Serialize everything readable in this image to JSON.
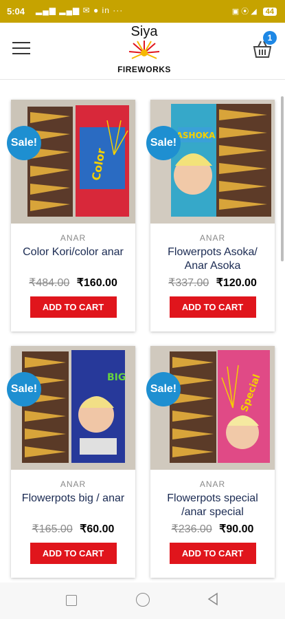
{
  "status": {
    "time": "5:04",
    "icons": "▂▄▆ ▂▄▆ ✉ ● in ···",
    "right": "▣ ⦿ ◢",
    "battery": "44"
  },
  "header": {
    "logo_top": "Siya",
    "logo_bottom": "FIREWORKS",
    "cart_count": "1"
  },
  "products": [
    {
      "category": "ANAR",
      "name": "Color Kori/color anar",
      "old_price": "₹484.00",
      "price": "₹160.00",
      "badge": "Sale!",
      "button": "ADD TO CART"
    },
    {
      "category": "ANAR",
      "name": "Flowerpots Asoka/ Anar Asoka",
      "old_price": "₹337.00",
      "price": "₹120.00",
      "badge": "Sale!",
      "button": "ADD TO CART"
    },
    {
      "category": "ANAR",
      "name": "Flowerpots big / anar",
      "old_price": "₹165.00",
      "price": "₹60.00",
      "badge": "Sale!",
      "button": "ADD TO CART"
    },
    {
      "category": "ANAR",
      "name": "Flowerpots special /anar special",
      "old_price": "₹236.00",
      "price": "₹90.00",
      "badge": "Sale!",
      "button": "ADD TO CART"
    }
  ],
  "colors": {
    "status_bar": "#c6a300",
    "sale_badge": "#1e8fd1",
    "add_to_cart": "#e0151c",
    "product_name": "#1a2a52"
  }
}
